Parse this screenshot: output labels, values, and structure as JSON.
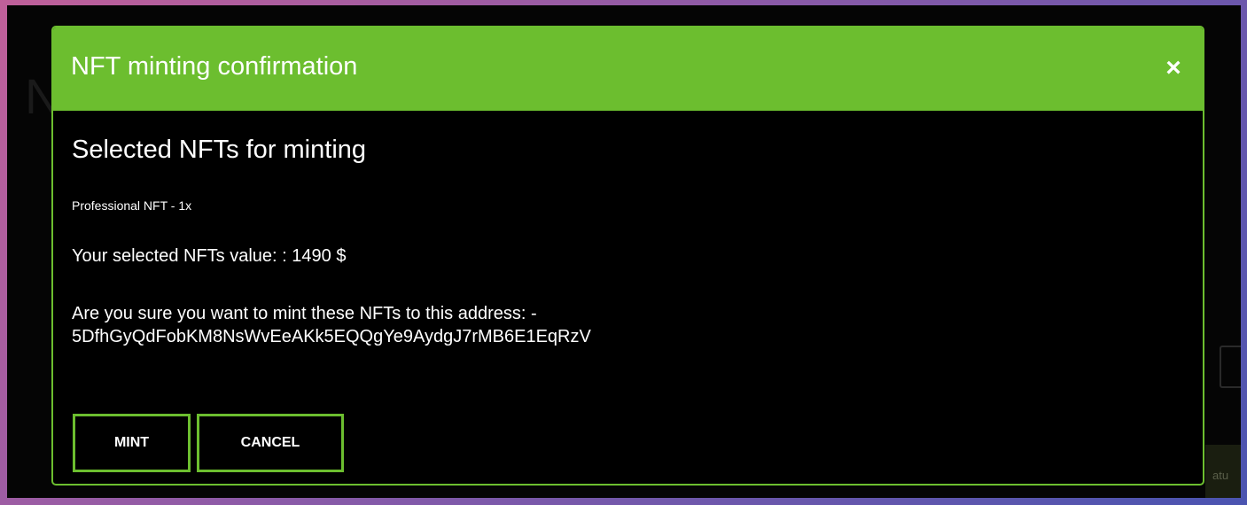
{
  "modal": {
    "title": "NFT minting confirmation",
    "close_symbol": "×",
    "heading": "Selected NFTs for minting",
    "nft_item": "Professional NFT - 1x",
    "value_line": "Your selected NFTs value: : 1490 $",
    "confirm_prompt": "Are you sure you want to mint these NFTs to this address: -",
    "address": "5DfhGyQdFobKM8NsWvEeAKk5EQQgYe9AydgJ7rMB6E1EqRzV",
    "mint_label": "MINT",
    "cancel_label": "CANCEL"
  },
  "background": {
    "ghost_letter": "N",
    "ghost_strip_text": "atu"
  },
  "colors": {
    "accent": "#6cbe2f",
    "modal_bg": "#000000",
    "text": "#ffffff"
  }
}
